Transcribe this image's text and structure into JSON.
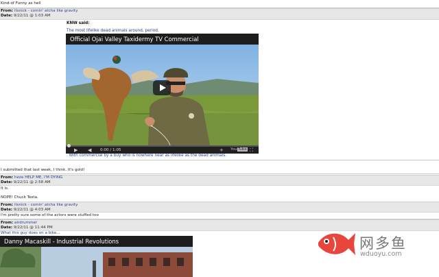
{
  "thread": {
    "top_comment": "Kind-of Funny as hell",
    "posts": [
      {
        "from_label": "From:",
        "from": "itsnick - comin' atcha like gravity",
        "date_label": "Date:",
        "date": "9/22/11 @ 1:03 AM",
        "quote_author": "KNW said:",
        "quote_intro": "The most lifelike dead animals around, period.",
        "video_title": "Official Ojai Valley Taxidermy TV Commercial",
        "video_time": "0:00 / 1:05",
        "quote_outro": ". With commercial by a buy who is nowhere near as lifelike as the dead animals.",
        "body": "I submitted that last week, I think. It's gold!"
      },
      {
        "from_label": "From:",
        "from": "heze HELP ME, I'M DYING",
        "date_label": "Date:",
        "date": "9/22/11 @ 2:58 AM",
        "body_1": "It is.",
        "body_2": "NOPE! Chuck Testa."
      },
      {
        "from_label": "From:",
        "from": "itsnick - comin' atcha like gravity",
        "date_label": "Date:",
        "date": "9/22/11 @ 4:03 AM",
        "body": "I'm pretty sure some of the actors were stuffed too"
      },
      {
        "from_label": "From:",
        "from": "airdrummer",
        "date_label": "Date:",
        "date": "9/22/11 @ 11:44 PM",
        "body": "What this guy does on a bike...",
        "video_title": "Danny Macaskill - Industrial Revolutions"
      }
    ]
  },
  "watermark": {
    "text": "网多鱼",
    "url": "wduoyu.com"
  },
  "colors": {
    "link": "#2a3e8c",
    "bar": "#e7e7e7",
    "watermark_fish": "#e8453c"
  },
  "icons": [
    "play-icon",
    "volume-icon",
    "youtube-logo-icon",
    "fullscreen-icon",
    "fish-logo-icon"
  ]
}
